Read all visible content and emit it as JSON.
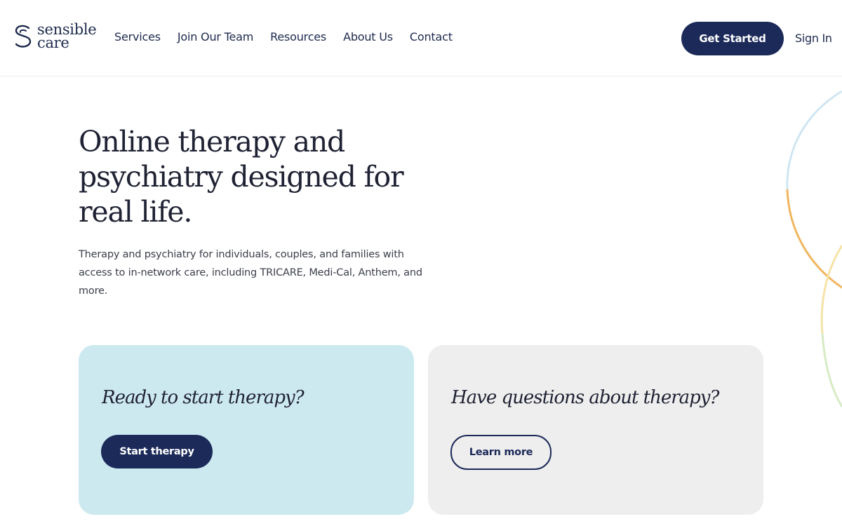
{
  "brand": {
    "name_line1": "sensible",
    "name_line2": "care",
    "logo_icon": "s-logo-icon",
    "color": "#1d2a4d"
  },
  "nav": {
    "items": [
      "Services",
      "Join Our Team",
      "Resources",
      "About Us",
      "Contact"
    ]
  },
  "header": {
    "cta_label": "Get Started",
    "signin_label": "Sign In"
  },
  "hero": {
    "title": "Online therapy and psychiatry designed for real life.",
    "subtitle": "Therapy and psychiatry for individuals, couples, and families with access to in-network care, including TRICARE, Medi-Cal, Anthem, and more."
  },
  "cards": [
    {
      "title": "Ready to start therapy?",
      "button": "Start therapy",
      "background": "#cde9f0"
    },
    {
      "title": "Have questions about therapy?",
      "button": "Learn more",
      "background": "#eeeeee"
    }
  ],
  "colors": {
    "primary": "#1c2a59",
    "arc_blue": "#cfe6f2",
    "arc_orange": "#f0b65f",
    "arc_yellow": "#f6e3a8",
    "arc_green": "#d6ebc4"
  }
}
